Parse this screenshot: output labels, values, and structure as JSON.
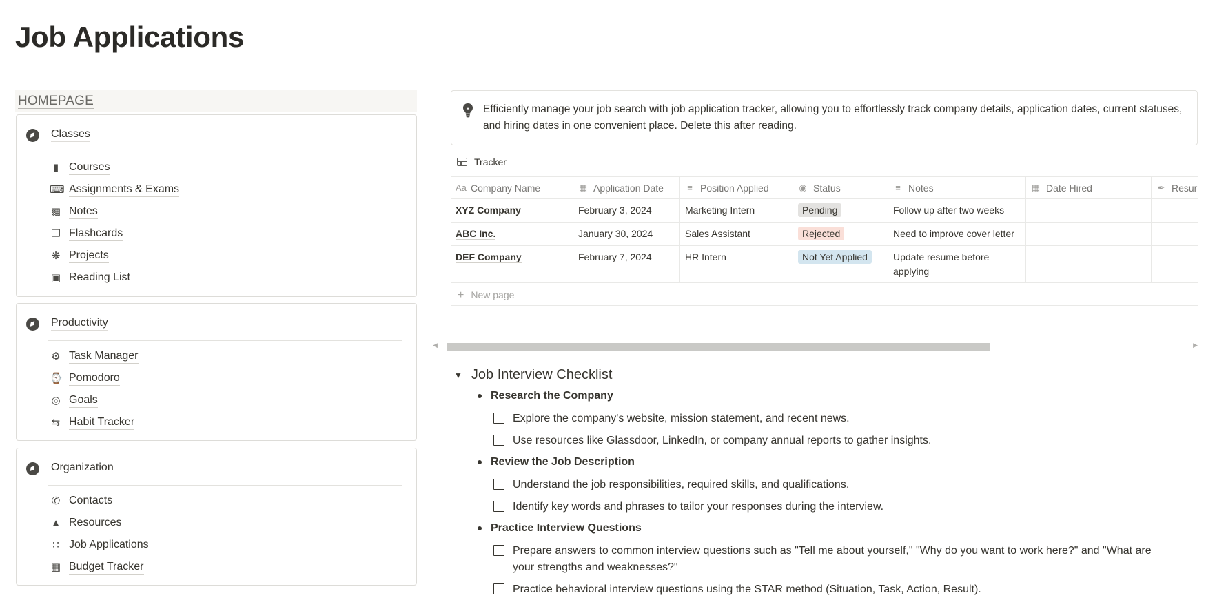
{
  "page": {
    "title": "Job Applications"
  },
  "homepage_label": "HOMEPAGE",
  "sections": [
    {
      "title": "Classes",
      "items": [
        {
          "icon": "bookmark-icon",
          "label": "Courses"
        },
        {
          "icon": "keyboard-icon",
          "label": "Assignments & Exams"
        },
        {
          "icon": "document-icon",
          "label": "Notes"
        },
        {
          "icon": "copy-icon",
          "label": "Flashcards"
        },
        {
          "icon": "atom-icon",
          "label": "Projects"
        },
        {
          "icon": "book-icon",
          "label": "Reading List"
        }
      ]
    },
    {
      "title": "Productivity",
      "items": [
        {
          "icon": "gear-icon",
          "label": "Task Manager"
        },
        {
          "icon": "watch-icon",
          "label": "Pomodoro"
        },
        {
          "icon": "target-icon",
          "label": "Goals"
        },
        {
          "icon": "sync-icon",
          "label": "Habit Tracker"
        }
      ]
    },
    {
      "title": "Organization",
      "items": [
        {
          "icon": "phone-icon",
          "label": "Contacts"
        },
        {
          "icon": "tree-icon",
          "label": "Resources"
        },
        {
          "icon": "grid-icon",
          "label": "Job Applications"
        },
        {
          "icon": "calculator-icon",
          "label": "Budget Tracker"
        }
      ]
    }
  ],
  "callout": {
    "icon": "lightbulb-icon",
    "text": "Efficiently manage your job search with job application tracker, allowing you to effortlessly track company details, application dates, current statuses, and hiring dates in one convenient place. Delete this after reading."
  },
  "tracker": {
    "view_label": "Tracker",
    "columns": [
      {
        "icon": "Aa",
        "label": "Company Name"
      },
      {
        "icon": "calendar-icon",
        "label": "Application Date"
      },
      {
        "icon": "text-lines-icon",
        "label": "Position Applied"
      },
      {
        "icon": "status-icon",
        "label": "Status"
      },
      {
        "icon": "text-lines-icon",
        "label": "Notes"
      },
      {
        "icon": "calendar-icon",
        "label": "Date Hired"
      },
      {
        "icon": "paperclip-icon",
        "label": "Resur"
      }
    ],
    "rows": [
      {
        "company": "XYZ Company",
        "date": "February 3, 2024",
        "position": "Marketing Intern",
        "status": "Pending",
        "status_color": "#e3e2e0",
        "notes": "Follow up after two weeks",
        "notes2": ""
      },
      {
        "company": "ABC Inc.",
        "date": "January 30, 2024",
        "position": "Sales Assistant",
        "status": "Rejected",
        "status_color": "#fadfd8",
        "notes": "Need to improve cover letter",
        "notes2": ""
      },
      {
        "company": "DEF Company",
        "date": "February 7, 2024",
        "position": "HR Intern",
        "status": "Not Yet Applied",
        "status_color": "#d3e5ef",
        "notes": "Update resume before",
        "notes2": "applying"
      }
    ],
    "new_page_label": "New page"
  },
  "checklist": {
    "title": "Job Interview Checklist",
    "groups": [
      {
        "heading": "Research the Company",
        "todos": [
          "Explore the company's website, mission statement, and recent news.",
          "Use resources like Glassdoor, LinkedIn, or company annual reports to gather insights."
        ]
      },
      {
        "heading": "Review the Job Description",
        "todos": [
          "Understand the job responsibilities, required skills, and qualifications.",
          "Identify key words and phrases to tailor your responses during the interview."
        ]
      },
      {
        "heading": "Practice Interview Questions",
        "todos": [
          "Prepare answers to common interview questions such as \"Tell me about yourself,\" \"Why do you want to work here?\" and \"What are your strengths and weaknesses?\"",
          "Practice behavioral interview questions using the STAR method (Situation, Task, Action, Result)."
        ]
      }
    ]
  }
}
